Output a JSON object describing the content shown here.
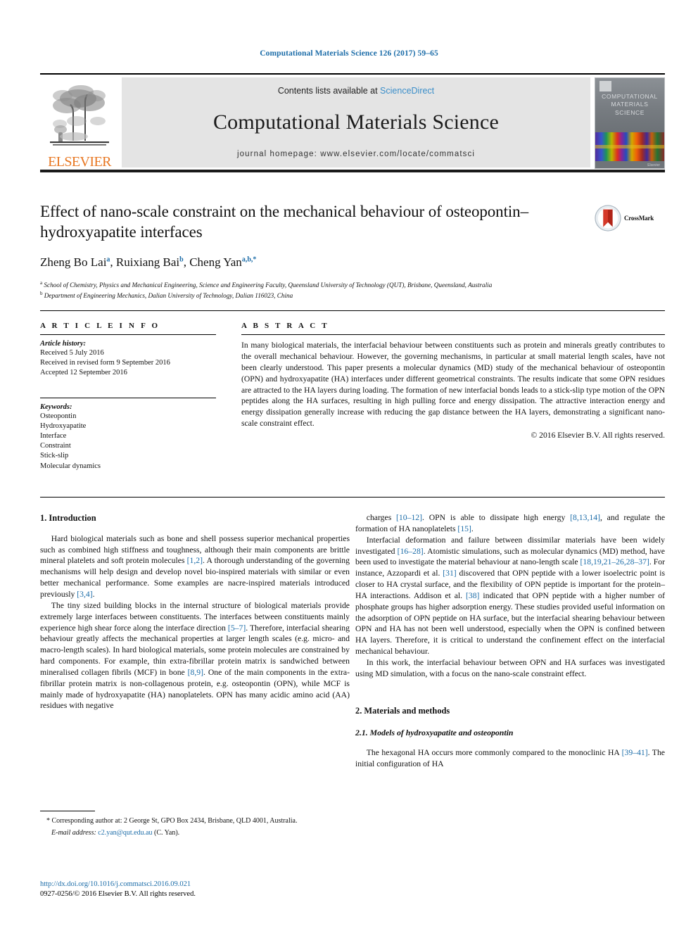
{
  "running_head": "Computational Materials Science 126 (2017) 59–65",
  "masthead": {
    "publisher": "ELSEVIER",
    "contents_prefix": "Contents lists available at ",
    "contents_link": "ScienceDirect",
    "journal_name": "Computational Materials Science",
    "homepage": "journal homepage: www.elsevier.com/locate/commatsci",
    "cover_title_line1": "COMPUTATIONAL",
    "cover_title_line2": "MATERIALS",
    "cover_title_line3": "SCIENCE",
    "cover_publisher": "Elsevier"
  },
  "article": {
    "title": "Effect of nano-scale constraint on the mechanical behaviour of osteopontin–hydroxyapatite interfaces",
    "authors": [
      {
        "name": "Zheng Bo Lai",
        "marks": "a"
      },
      {
        "name": "Ruixiang Bai",
        "marks": "b"
      },
      {
        "name": "Cheng Yan",
        "marks": "a,b,*"
      }
    ],
    "affiliations": [
      {
        "mark": "a",
        "text": "School of Chemistry, Physics and Mechanical Engineering, Science and Engineering Faculty, Queensland University of Technology (QUT), Brisbane, Queensland, Australia"
      },
      {
        "mark": "b",
        "text": "Department of Engineering Mechanics, Dalian University of Technology, Dalian 116023, China"
      }
    ],
    "crossmark_label": "CrossMark"
  },
  "info": {
    "heading": "A R T I C L E   I N F O",
    "history_label": "Article history:",
    "history": [
      "Received 5 July 2016",
      "Received in revised form 9 September 2016",
      "Accepted 12 September 2016"
    ],
    "keywords_label": "Keywords:",
    "keywords": [
      "Osteopontin",
      "Hydroxyapatite",
      "Interface",
      "Constraint",
      "Stick-slip",
      "Molecular dynamics"
    ]
  },
  "abstract": {
    "heading": "A B S T R A C T",
    "text": "In many biological materials, the interfacial behaviour between constituents such as protein and minerals greatly contributes to the overall mechanical behaviour. However, the governing mechanisms, in particular at small material length scales, have not been clearly understood. This paper presents a molecular dynamics (MD) study of the mechanical behaviour of osteopontin (OPN) and hydroxyapatite (HA) interfaces under different geometrical constraints. The results indicate that some OPN residues are attracted to the HA layers during loading. The formation of new interfacial bonds leads to a stick-slip type motion of the OPN peptides along the HA surfaces, resulting in high pulling force and energy dissipation. The attractive interaction energy and energy dissipation generally increase with reducing the gap distance between the HA layers, demonstrating a significant nano-scale constraint effect.",
    "copyright": "© 2016 Elsevier B.V. All rights reserved."
  },
  "body": {
    "left": {
      "section_heading": "1. Introduction",
      "paragraphs": [
        "Hard biological materials such as bone and shell possess superior mechanical properties such as combined high stiffness and toughness, although their main components are brittle mineral platelets and soft protein molecules [1,2]. A thorough understanding of the governing mechanisms will help design and develop novel bio-inspired materials with similar or even better mechanical performance. Some examples are nacre-inspired materials introduced previously [3,4].",
        "The tiny sized building blocks in the internal structure of biological materials provide extremely large interfaces between constituents. The interfaces between constituents mainly experience high shear force along the interface direction [5–7]. Therefore, interfacial shearing behaviour greatly affects the mechanical properties at larger length scales (e.g. micro- and macro-length scales). In hard biological materials, some protein molecules are constrained by hard components. For example, thin extra-fibrillar protein matrix is sandwiched between mineralised collagen fibrils (MCF) in bone [8,9]. One of the main components in the extra-fibrillar protein matrix is non-collagenous protein, e.g. osteopontin (OPN), while MCF is mainly made of hydroxyapatite (HA) nanoplatelets. OPN has many acidic amino acid (AA) residues with negative"
      ]
    },
    "right": {
      "paragraphs": [
        "charges [10–12]. OPN is able to dissipate high energy [8,13,14], and regulate the formation of HA nanoplatelets [15].",
        "Interfacial deformation and failure between dissimilar materials have been widely investigated [16–28]. Atomistic simulations, such as molecular dynamics (MD) method, have been used to investigate the material behaviour at nano-length scale [18,19,21–26,28–37]. For instance, Azzopardi et al. [31] discovered that OPN peptide with a lower isoelectric point is closer to HA crystal surface, and the flexibility of OPN peptide is important for the protein–HA interactions. Addison et al. [38] indicated that OPN peptide with a higher number of phosphate groups has higher adsorption energy. These studies provided useful information on the adsorption of OPN peptide on HA surface, but the interfacial shearing behaviour between OPN and HA has not been well understood, especially when the OPN is confined between HA layers. Therefore, it is critical to understand the confinement effect on the interfacial mechanical behaviour.",
        "In this work, the interfacial behaviour between OPN and HA surfaces was investigated using MD simulation, with a focus on the nano-scale constraint effect."
      ],
      "section_heading": "2. Materials and methods",
      "subsection_heading": "2.1. Models of hydroxyapatite and osteopontin",
      "last_paragraph": "The hexagonal HA occurs more commonly compared to the monoclinic HA [39–41]. The initial configuration of HA"
    }
  },
  "footnotes": {
    "corresponding": "* Corresponding author at: 2 George St, GPO Box 2434, Brisbane, QLD 4001, Australia.",
    "email_label": "E-mail address:",
    "email": "c2.yan@qut.edu.au",
    "email_suffix": "(C. Yan).",
    "doi": "http://dx.doi.org/10.1016/j.commatsci.2016.09.021",
    "issn_line": "0927-0256/© 2016 Elsevier B.V. All rights reserved."
  },
  "colors": {
    "link": "#1b6ca8",
    "sciencedirect": "#3a8ec9",
    "elsevier_orange": "#e87722",
    "band_gray": "#e4e4e4"
  }
}
